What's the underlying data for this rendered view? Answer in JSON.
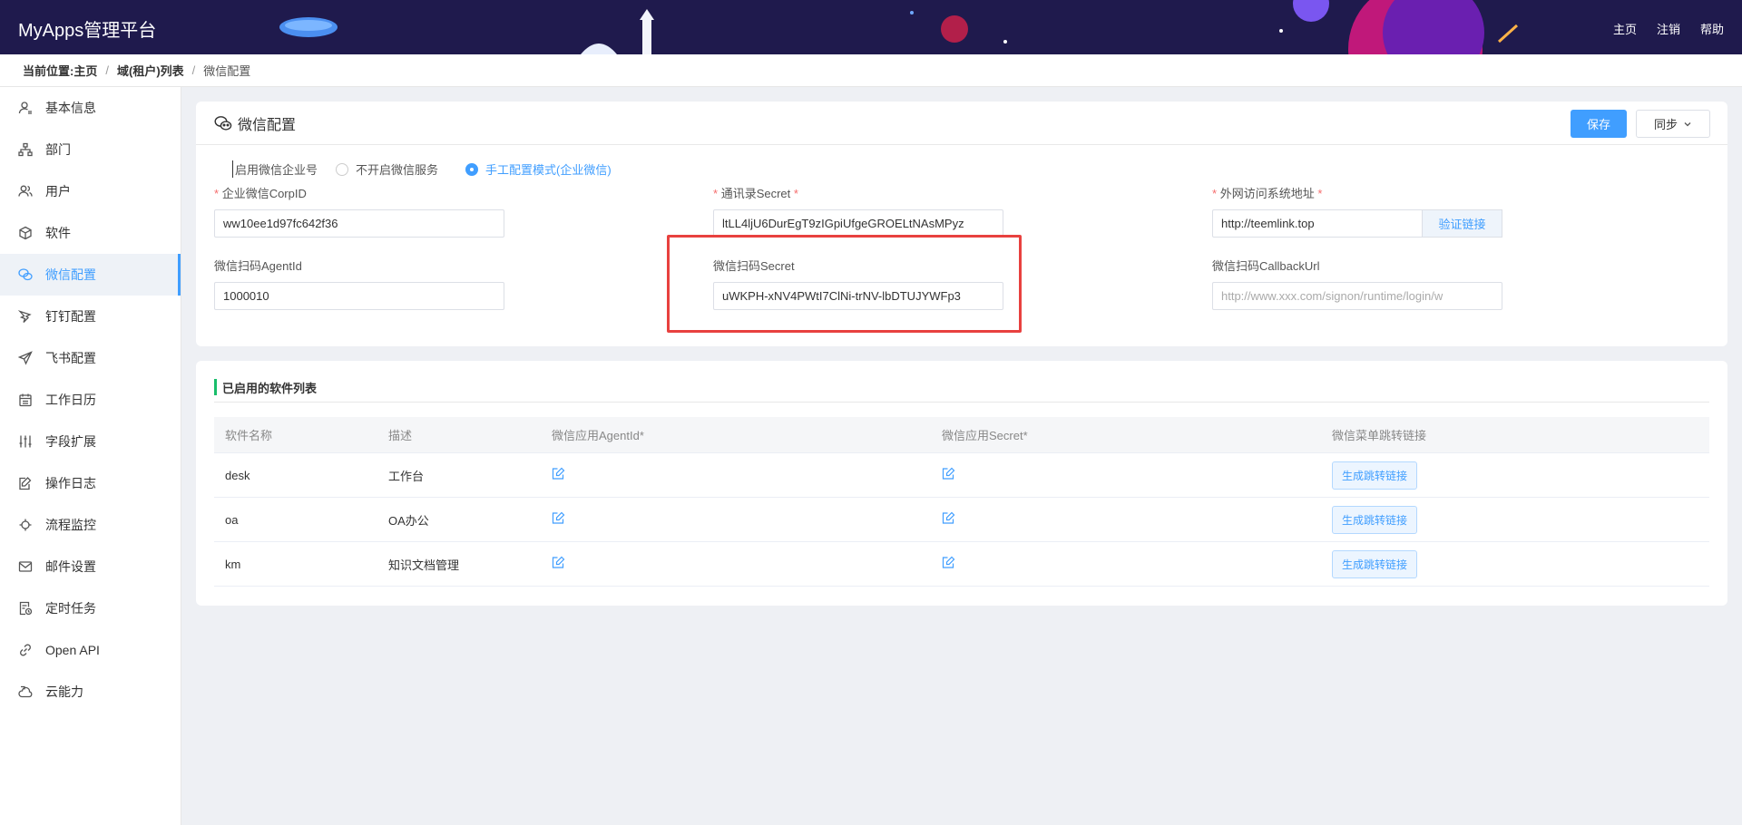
{
  "header": {
    "logo": "MyApps管理平台",
    "nav": [
      "主页",
      "注销",
      "帮助"
    ]
  },
  "breadcrumb": {
    "label": "当前位置:",
    "items": [
      "主页",
      "域(租户)列表",
      "微信配置"
    ],
    "separator": "/"
  },
  "sidebar": {
    "items": [
      {
        "label": "基本信息",
        "icon": "user-info-icon"
      },
      {
        "label": "部门",
        "icon": "org-tree-icon"
      },
      {
        "label": "用户",
        "icon": "users-icon"
      },
      {
        "label": "软件",
        "icon": "cube-icon"
      },
      {
        "label": "微信配置",
        "icon": "wechat-icon",
        "active": true
      },
      {
        "label": "钉钉配置",
        "icon": "dingtalk-icon"
      },
      {
        "label": "飞书配置",
        "icon": "paper-plane-icon"
      },
      {
        "label": "工作日历",
        "icon": "calendar-icon"
      },
      {
        "label": "字段扩展",
        "icon": "sliders-icon"
      },
      {
        "label": "操作日志",
        "icon": "edit-log-icon"
      },
      {
        "label": "流程监控",
        "icon": "monitor-icon"
      },
      {
        "label": "邮件设置",
        "icon": "mail-icon"
      },
      {
        "label": "定时任务",
        "icon": "timer-icon"
      },
      {
        "label": "Open API",
        "icon": "link-icon"
      },
      {
        "label": "云能力",
        "icon": "cloud-icon"
      }
    ]
  },
  "config": {
    "title": "微信配置",
    "save_label": "保存",
    "sync_label": "同步",
    "radio_label": "启用微信企业号",
    "radio_options": [
      "不开启微信服务",
      "手工配置模式(企业微信)"
    ],
    "radio_selected": 1,
    "fields": {
      "corp_id": {
        "label": "企业微信CorpID",
        "value": "ww10ee1d97fc642f36"
      },
      "contacts_secret": {
        "label": "通讯录Secret",
        "value": "ltLL4ljU6DurEgT9zIGpiUfgeGROELtNAsMPyz"
      },
      "external_url": {
        "label": "外网访问系统地址",
        "value": "http://teemlink.top",
        "button": "验证链接"
      },
      "scan_agent_id": {
        "label": "微信扫码AgentId",
        "value": "1000010"
      },
      "scan_secret": {
        "label": "微信扫码Secret",
        "value": "uWKPH-xNV4PWtI7ClNi-trNV-lbDTUJYWFp3"
      },
      "callback_url": {
        "label": "微信扫码CallbackUrl",
        "placeholder": "http://www.xxx.com/signon/runtime/login/w"
      }
    },
    "required_mark": "*"
  },
  "software": {
    "title": "已启用的软件列表",
    "columns": [
      "软件名称",
      "描述",
      "微信应用AgentId*",
      "微信应用Secret*",
      "微信菜单跳转链接"
    ],
    "rows": [
      {
        "name": "desk",
        "desc": "工作台",
        "link_label": "生成跳转链接"
      },
      {
        "name": "oa",
        "desc": "OA办公",
        "link_label": "生成跳转链接"
      },
      {
        "name": "km",
        "desc": "知识文档管理",
        "link_label": "生成跳转链接"
      }
    ]
  },
  "colors": {
    "primary": "#409eff",
    "header_bg": "#1f1a4d",
    "required": "#f56c6c",
    "highlight": "#e8413f",
    "section_accent": "#19be6b"
  }
}
